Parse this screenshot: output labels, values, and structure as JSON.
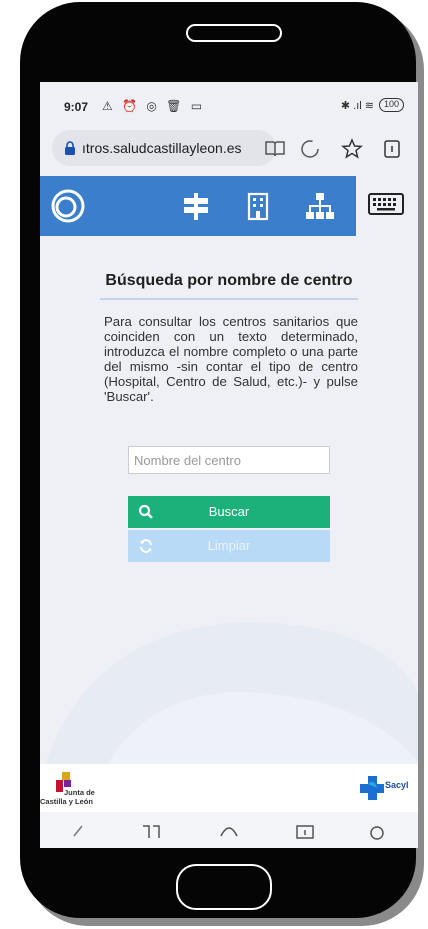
{
  "status_bar": {
    "time": "9:07",
    "left_icons": "⚠ ⏰ ◎ 🗑 ▭",
    "right_icons": "✱ .ıl ≋",
    "battery": "100"
  },
  "browser": {
    "url": "ıtros.saludcastillayleon.es"
  },
  "app": {
    "accent_color": "#3a7ecc",
    "nav_icons": [
      "logo-ring-icon",
      "signpost-icon",
      "building-icon",
      "sitemap-icon",
      "keyboard-icon"
    ]
  },
  "search_section": {
    "title": "Búsqueda por nombre de centro",
    "description": "Para consultar los centros sanitarios que coinciden con un texto determinado, introduzca el nombre completo o una parte del mismo -sin contar el tipo de centro (Hospital, Centro de Salud, etc.)- y pulse 'Buscar'.",
    "input_placeholder": "Nombre del centro",
    "input_value": "",
    "search_button": "Buscar",
    "clear_button": "Limpiar",
    "search_color": "#1cb07a",
    "clear_color": "#b9daf7"
  },
  "footer": {
    "jcyl_line1": "Junta de",
    "jcyl_line2": "Castilla y León",
    "sacyl": "Sacyl"
  }
}
